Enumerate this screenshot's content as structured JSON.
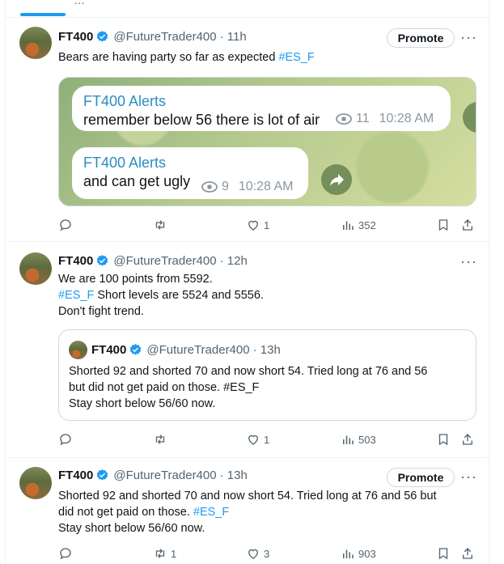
{
  "tab": {
    "label": "…"
  },
  "tweets": [
    {
      "name": "FT400",
      "handle": "@FutureTrader400",
      "time": "· 11h",
      "promote": "Promote",
      "more": "···",
      "text_a": "Bears are having party so far as expected ",
      "text_b": "#ES_F",
      "media": {
        "b1_title": "FT400 Alerts",
        "b1_text": "remember below 56 there is lot of air",
        "b1_views": "11",
        "b1_time": "10:28 AM",
        "b2_title": "FT400 Alerts",
        "b2_text": "and can get ugly",
        "b2_views": "9",
        "b2_time": "10:28 AM"
      },
      "reply_count": "",
      "retweet_count": "",
      "like_count": "1",
      "view_count": "352"
    },
    {
      "name": "FT400",
      "handle": "@FutureTrader400",
      "time": "· 12h",
      "more": "···",
      "line1": "We are 100 points from 5592.",
      "line2_tag": "#ES_F",
      "line2_rest": " Short levels are 5524 and 5556.",
      "line3": "Don't fight trend.",
      "quote": {
        "name": "FT400",
        "handle": "@FutureTrader400",
        "time": "· 13h",
        "line1": "Shorted 92 and shorted 70 and now short 54. Tried long at 76 and 56",
        "line2_a": "but did not get paid on those. ",
        "line2_tag": "#ES_F",
        "line3": "Stay short below 56/60 now."
      },
      "reply_count": "",
      "retweet_count": "",
      "like_count": "1",
      "view_count": "503"
    },
    {
      "name": "FT400",
      "handle": "@FutureTrader400",
      "time": "· 13h",
      "promote": "Promote",
      "more": "···",
      "line1": "Shorted 92 and shorted 70 and now short 54. Tried long at 76 and 56 but",
      "line2_a": "did not get paid on those. ",
      "line2_tag": "#ES_F",
      "line3": "Stay short below 56/60 now.",
      "reply_count": "",
      "retweet_count": "1",
      "like_count": "3",
      "view_count": "903"
    }
  ],
  "colors": {
    "accent": "#1d9bf0",
    "text": "#0f1419",
    "muted": "#536471",
    "alerts_title": "#2a8ec1"
  }
}
